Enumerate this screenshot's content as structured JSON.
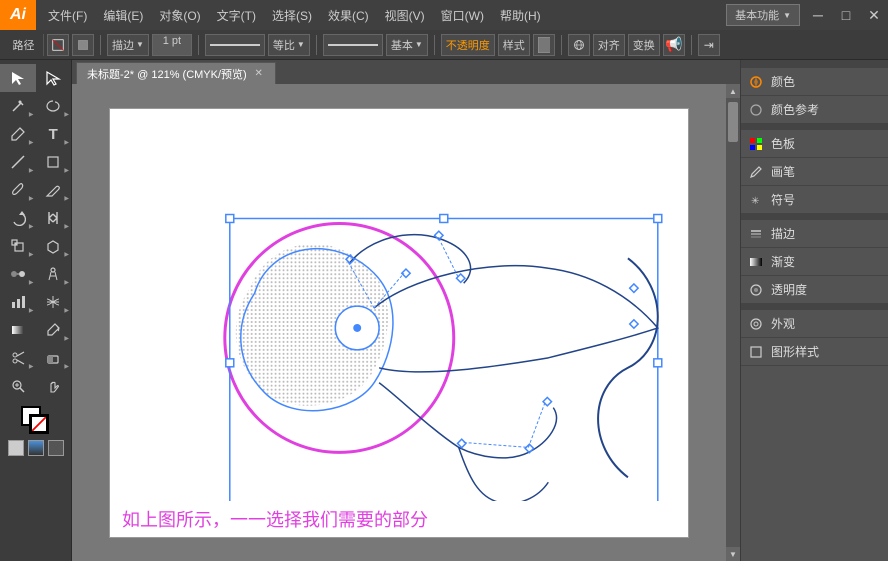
{
  "app": {
    "logo": "Ai",
    "title": "未标题-2* @ 121% (CMYK/预览)"
  },
  "menu": {
    "items": [
      "文件(F)",
      "编辑(E)",
      "对象(O)",
      "文字(T)",
      "选择(S)",
      "效果(C)",
      "视图(V)",
      "窗口(W)",
      "帮助(H)"
    ]
  },
  "window_controls": {
    "minimize": "─",
    "maximize": "□",
    "close": "✕"
  },
  "toolbar": {
    "path_label": "路径",
    "stroke_icon": "pencil",
    "fill_icon": "rect",
    "mode_label": "描边",
    "weight_value": "1 pt",
    "line_style": "等比",
    "basic_label": "基本",
    "opacity_label": "不透明度",
    "style_label": "样式",
    "align_label": "对齐",
    "transform_label": "变换",
    "basic_func_label": "基本功能",
    "arrange_label": "描边",
    "gradient_label": "渐变",
    "transparency_label": "透明度"
  },
  "tab": {
    "title": "未标题-2* @ 121% (CMYK/预览)",
    "close": "✕"
  },
  "right_panel": {
    "items": [
      {
        "id": "color",
        "icon": "🎨",
        "label": "颜色"
      },
      {
        "id": "color-ref",
        "icon": "🎨",
        "label": "颜色参考"
      },
      {
        "id": "swatches",
        "icon": "▦",
        "label": "色板"
      },
      {
        "id": "brush",
        "icon": "🖌",
        "label": "画笔"
      },
      {
        "id": "symbol",
        "icon": "✳",
        "label": "符号"
      },
      {
        "id": "stroke",
        "icon": "≡",
        "label": "描边"
      },
      {
        "id": "gradient",
        "icon": "◫",
        "label": "渐变"
      },
      {
        "id": "transparency",
        "icon": "◎",
        "label": "透明度"
      },
      {
        "id": "appearance",
        "icon": "◎",
        "label": "外观"
      },
      {
        "id": "graphic-style",
        "icon": "⬜",
        "label": "图形样式"
      }
    ]
  },
  "caption": {
    "text": "如上图所示，一一选择我们需要的部分"
  },
  "tools": [
    {
      "id": "arrow",
      "symbol": "↖",
      "has_sub": false
    },
    {
      "id": "direct-select",
      "symbol": "↗",
      "has_sub": false
    },
    {
      "id": "pen",
      "symbol": "✒",
      "has_sub": true
    },
    {
      "id": "type",
      "symbol": "T",
      "has_sub": true
    },
    {
      "id": "line",
      "symbol": "/",
      "has_sub": true
    },
    {
      "id": "rect",
      "symbol": "□",
      "has_sub": true
    },
    {
      "id": "paint",
      "symbol": "🖌",
      "has_sub": true
    },
    {
      "id": "rotate",
      "symbol": "↻",
      "has_sub": true
    },
    {
      "id": "scale",
      "symbol": "⤡",
      "has_sub": true
    },
    {
      "id": "eraser",
      "symbol": "◻",
      "has_sub": true
    },
    {
      "id": "zoom",
      "symbol": "🔍",
      "has_sub": false
    },
    {
      "id": "hand",
      "symbol": "✋",
      "has_sub": false
    },
    {
      "id": "fill",
      "symbol": "■",
      "has_sub": false
    },
    {
      "id": "stroke-box",
      "symbol": "□",
      "has_sub": false
    }
  ]
}
